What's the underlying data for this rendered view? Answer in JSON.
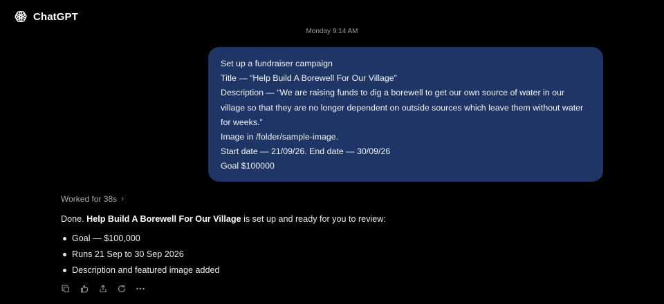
{
  "app": {
    "title": "ChatGPT",
    "logo_icon": "openai-logo-icon"
  },
  "conversation": {
    "timestamp": "Monday 9:14 AM",
    "user_message": {
      "lines": [
        "Set up a fundraiser campaign",
        "Title — “Help Build A Borewell For Our Village”",
        "Description — “We are raising funds to dig a borewell to get our own source of water in our",
        "village so that they are no longer dependent on outside sources which leave them without water",
        "for weeks.”",
        "Image in /folder/sample-image.",
        "Start date — 21/09/26. End date — 30/09/26",
        "Goal $100000"
      ]
    },
    "assistant": {
      "worked_label": "Worked for 38s",
      "intro_prefix": "Done. ",
      "intro_bold": "Help Build A Borewell For Our Village",
      "intro_suffix": " is set up and ready for you to review:",
      "bullets": [
        "Goal — $100,000",
        "Runs 21 Sep to 30 Sep 2026",
        "Description and featured image added"
      ],
      "actions": [
        "copy-icon",
        "thumbs-up-icon",
        "share-icon",
        "regenerate-icon",
        "more-icon"
      ]
    }
  },
  "colors": {
    "background": "#000000",
    "user_bubble": "#1f3566",
    "text": "#ececec",
    "muted": "#9a9a9a"
  }
}
